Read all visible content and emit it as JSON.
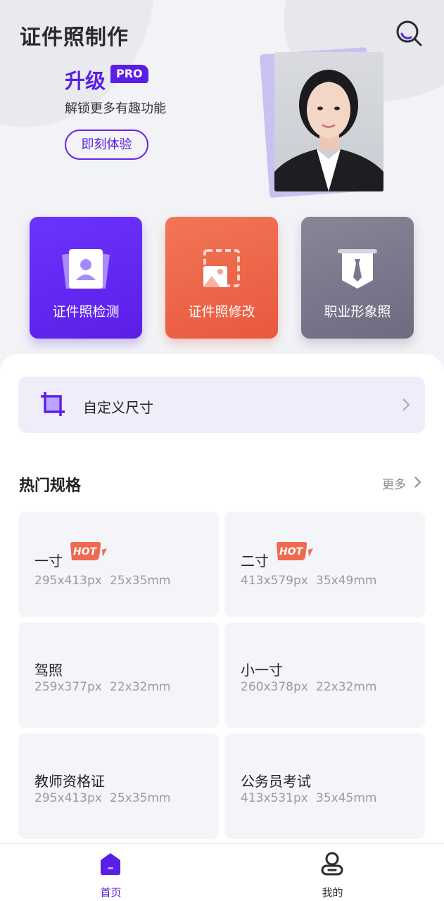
{
  "header": {
    "title": "证件照制作"
  },
  "promo": {
    "upgrade": "升级",
    "badge": "PRO",
    "subtitle": "解锁更多有趣功能",
    "cta": "即刻体验"
  },
  "features": [
    {
      "label": "证件照检测",
      "icon": "id-photo-check-icon",
      "color": "#5b1ee6"
    },
    {
      "label": "证件照修改",
      "icon": "photo-edit-icon",
      "color": "#ea5b3f"
    },
    {
      "label": "职业形象照",
      "icon": "suit-tie-icon",
      "color": "#716c82"
    }
  ],
  "custom_size": {
    "label": "自定义尺寸"
  },
  "popular": {
    "title": "热门规格",
    "more": "更多",
    "items": [
      {
        "name": "一寸",
        "px": "295x413px",
        "mm": "25x35mm",
        "hot": "HOT"
      },
      {
        "name": "二寸",
        "px": "413x579px",
        "mm": "35x49mm",
        "hot": "HOT"
      },
      {
        "name": "驾照",
        "px": "259x377px",
        "mm": "22x32mm"
      },
      {
        "name": "小一寸",
        "px": "260x378px",
        "mm": "22x32mm"
      },
      {
        "name": "教师资格证",
        "px": "295x413px",
        "mm": "25x35mm"
      },
      {
        "name": "公务员考试",
        "px": "413x531px",
        "mm": "35x45mm"
      }
    ]
  },
  "tabs": [
    {
      "label": "首页",
      "icon": "home-icon",
      "active": true
    },
    {
      "label": "我的",
      "icon": "profile-icon",
      "active": false
    }
  ],
  "colors": {
    "accent": "#5b1ee6",
    "hot": "#ef6a4e"
  }
}
